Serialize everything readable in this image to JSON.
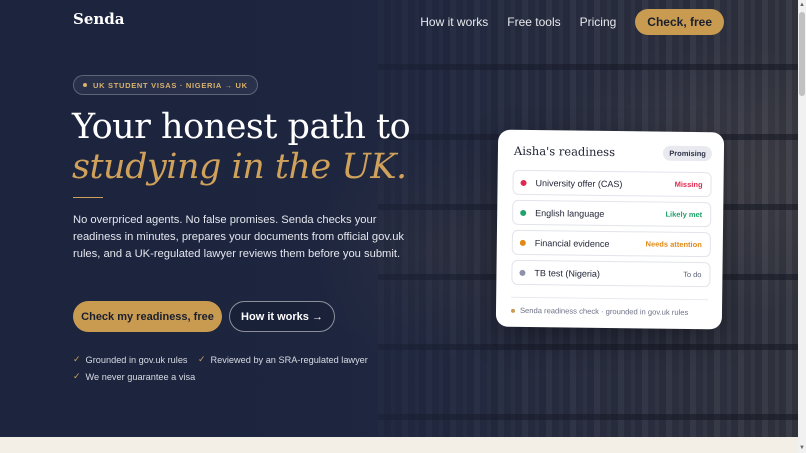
{
  "brand": {
    "name": "Senda"
  },
  "nav": {
    "links": [
      "How it works",
      "Free tools",
      "Pricing"
    ],
    "cta": "Check, free"
  },
  "hero": {
    "eyebrow": "UK STUDENT VISAS · NIGERIA → UK",
    "title_line1": "Your honest path to",
    "title_line2": "studying in the UK.",
    "lead": "No overpriced agents. No false promises. Senda checks your readiness in minutes, prepares your documents from official gov.uk rules, and a UK-regulated lawyer reviews them before you submit.",
    "primary_button": "Check my readiness, free",
    "secondary_button": "How it works →",
    "trust": [
      "Grounded in gov.uk rules",
      "Reviewed by an SRA-regulated lawyer",
      "We never guarantee a visa"
    ]
  },
  "card": {
    "title": "Aisha's readiness",
    "badge": "Promising",
    "items": [
      {
        "label": "University offer (CAS)",
        "status": "Missing",
        "color": "#e0294f"
      },
      {
        "label": "English language",
        "status": "Likely met",
        "color": "#1fa36a"
      },
      {
        "label": "Financial evidence",
        "status": "Needs attention",
        "color": "#e08a16"
      },
      {
        "label": "TB test (Nigeria)",
        "status": "To do",
        "color": "#8c93a6"
      }
    ],
    "footer": "Senda readiness check · grounded in gov.uk rules"
  },
  "colors": {
    "accent": "#c89b50",
    "navy": "#1c243e"
  }
}
